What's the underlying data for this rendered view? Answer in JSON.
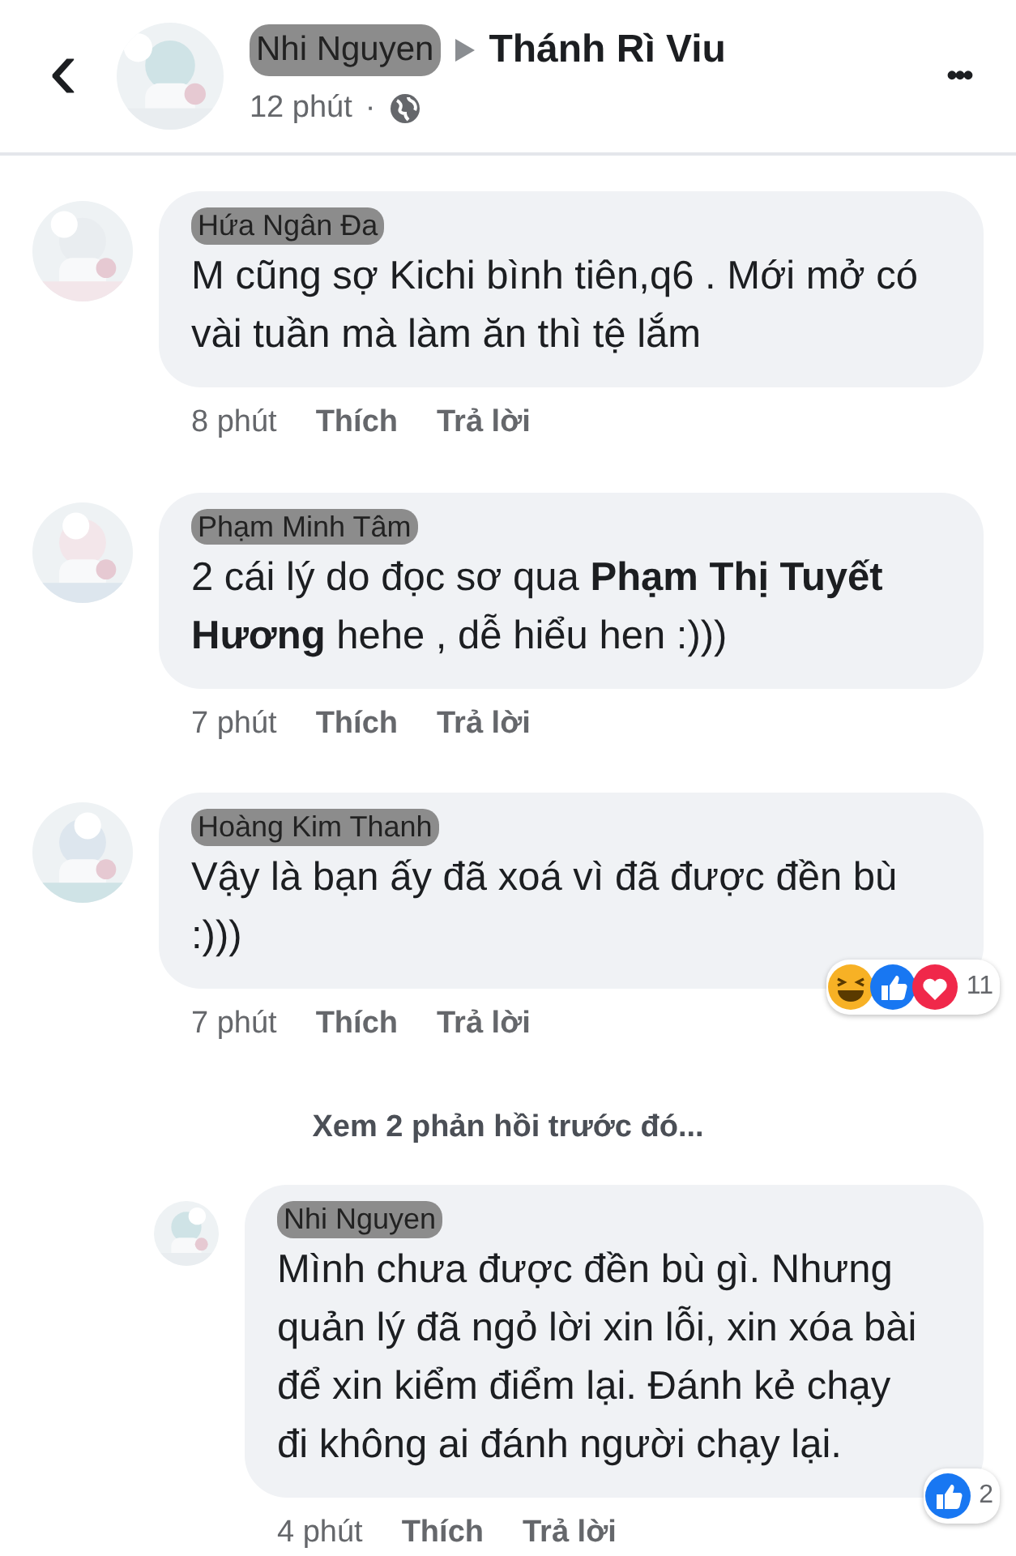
{
  "header": {
    "back": "‹",
    "author": "Nhi Nguyen",
    "target": "Thánh Rì Viu",
    "time": "12 phút",
    "separator": "·",
    "more": "•••"
  },
  "comments": [
    {
      "author": "Hứa Ngân Đa",
      "text": "M cũng sợ Kichi bình tiên,q6 . Mới mở có vài tuần mà làm ăn thì tệ lắm",
      "time": "8 phút",
      "like": "Thích",
      "reply": "Trả lời"
    },
    {
      "author": "Phạm Minh Tâm",
      "text": "2 cái lý do đọc sơ qua **Phạm Thị Tuyết Hương** hehe , dễ hiểu hen :)))",
      "time": "7 phút",
      "like": "Thích",
      "reply": "Trả lời"
    },
    {
      "author": "Hoàng Kim Thanh",
      "text": "Vậy là bạn ấy đã xoá vì đã được đền bù :)))",
      "time": "7 phút",
      "like": "Thích",
      "reply": "Trả lời",
      "reactions": [
        {
          "kind": "haha"
        },
        {
          "kind": "like"
        },
        {
          "kind": "love"
        }
      ],
      "reaction_count": "11"
    }
  ],
  "more_replies": "Xem 2 phản hồi trước đó...",
  "replies": [
    {
      "author": "Nhi Nguyen",
      "text": "Mình chưa được đền bù gì. Nhưng quản lý đã ngỏ lời xin lỗi, xin xóa bài để xin kiểm điểm lại. Đánh kẻ chạy đi không ai đánh người chạy lại.",
      "time": "4 phút",
      "like": "Thích",
      "reply": "Trả lời",
      "reactions": [
        {
          "kind": "like"
        }
      ],
      "reaction_count": "2"
    }
  ]
}
